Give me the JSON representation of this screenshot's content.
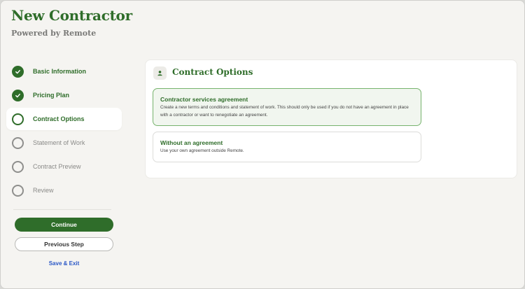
{
  "header": {
    "title": "New Contractor",
    "subtitle": "Powered by Remote"
  },
  "steps": [
    {
      "label": "Basic Information",
      "state": "done"
    },
    {
      "label": "Pricing Plan",
      "state": "done"
    },
    {
      "label": "Contract Options",
      "state": "active"
    },
    {
      "label": "Statement of Work",
      "state": "todo"
    },
    {
      "label": "Contract Preview",
      "state": "todo"
    },
    {
      "label": "Review",
      "state": "todo"
    }
  ],
  "actions": {
    "continue_label": "Continue",
    "previous_label": "Previous Step",
    "save_exit_label": "Save & Exit"
  },
  "card": {
    "title": "Contract Options",
    "icon": "person-icon",
    "options": [
      {
        "title": "Contractor services agreement",
        "description": "Create a new terms and conditions and statement of work. This should only be used if you do not have an agreement in place with a contractor or want to renegotiate an agreement.",
        "selected": true
      },
      {
        "title": "Without an agreement",
        "description": "Use your own agreement outside Remote.",
        "selected": false
      }
    ]
  },
  "colors": {
    "brand_green": "#2f6d2a",
    "link_blue": "#2a57c6",
    "selected_border": "#77b36d"
  }
}
